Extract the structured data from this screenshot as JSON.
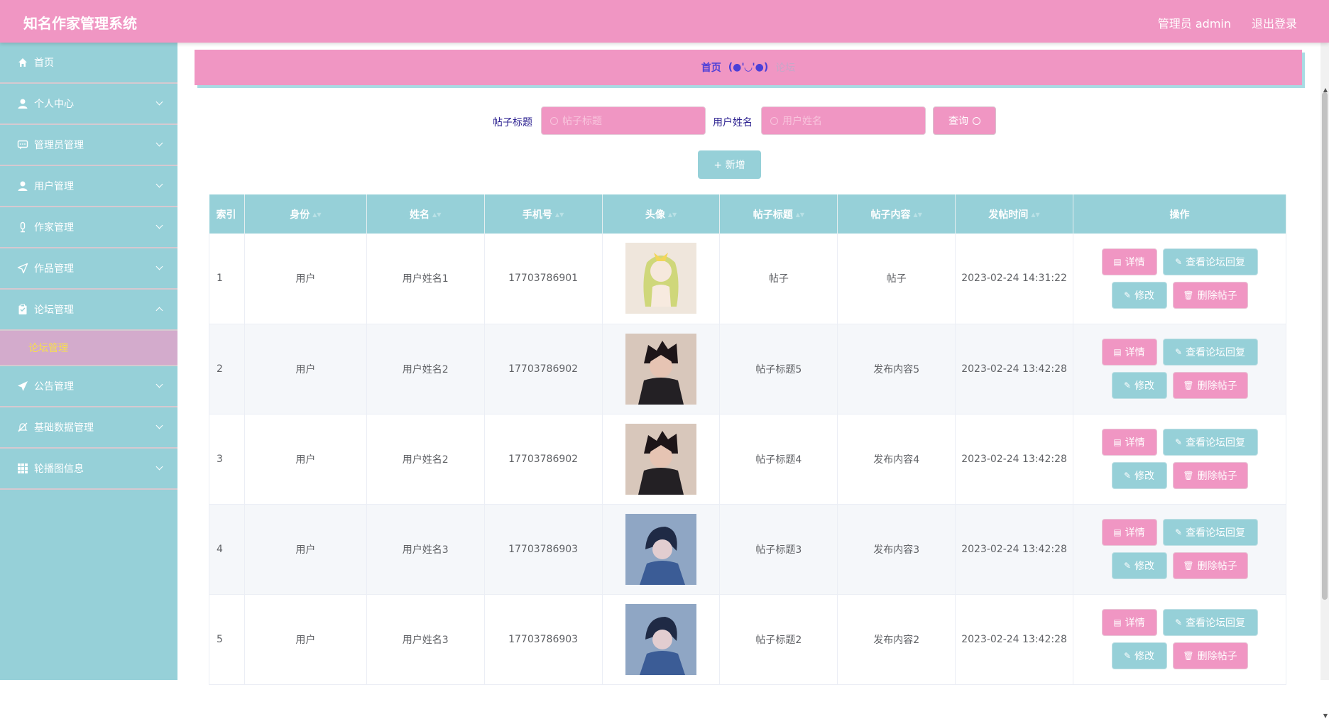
{
  "header": {
    "title": "知名作家管理系统",
    "admin": "管理员 admin",
    "logout": "退出登录"
  },
  "sidebar": {
    "items": [
      {
        "label": "首页",
        "icon": "home-icon"
      },
      {
        "label": "个人中心",
        "icon": "user-icon"
      },
      {
        "label": "管理员管理",
        "icon": "chat-icon"
      },
      {
        "label": "用户管理",
        "icon": "user-icon"
      },
      {
        "label": "作家管理",
        "icon": "microphone-icon"
      },
      {
        "label": "作品管理",
        "icon": "send-icon"
      },
      {
        "label": "论坛管理",
        "icon": "clipboard-icon",
        "expanded": true
      },
      {
        "label": "公告管理",
        "icon": "paper-plane-icon"
      },
      {
        "label": "基础数据管理",
        "icon": "bell-off-icon"
      },
      {
        "label": "轮播图信息",
        "icon": "grid-icon"
      }
    ],
    "submenu_label": "论坛管理"
  },
  "breadcrumb": {
    "home": "首页",
    "separator": "(●'◡'●)",
    "current": "论坛"
  },
  "search": {
    "title_label": "帖子标题",
    "title_placeholder": "帖子标题",
    "name_label": "用户姓名",
    "name_placeholder": "用户姓名",
    "query_label": "查询"
  },
  "add_label": "+ 新增",
  "table": {
    "headers": [
      "索引",
      "身份",
      "姓名",
      "手机号",
      "头像",
      "帖子标题",
      "帖子内容",
      "发帖时间",
      "操作"
    ],
    "rows": [
      {
        "index": "1",
        "role": "用户",
        "name": "用户姓名1",
        "phone": "17703786901",
        "title": "帖子",
        "content": "帖子",
        "time": "2023-02-24 14:31:22"
      },
      {
        "index": "2",
        "role": "用户",
        "name": "用户姓名2",
        "phone": "17703786902",
        "title": "帖子标题5",
        "content": "发布内容5",
        "time": "2023-02-24 13:42:28"
      },
      {
        "index": "3",
        "role": "用户",
        "name": "用户姓名2",
        "phone": "17703786902",
        "title": "帖子标题4",
        "content": "发布内容4",
        "time": "2023-02-24 13:42:28"
      },
      {
        "index": "4",
        "role": "用户",
        "name": "用户姓名3",
        "phone": "17703786903",
        "title": "帖子标题3",
        "content": "发布内容3",
        "time": "2023-02-24 13:42:28"
      },
      {
        "index": "5",
        "role": "用户",
        "name": "用户姓名3",
        "phone": "17703786903",
        "title": "帖子标题2",
        "content": "发布内容2",
        "time": "2023-02-24 13:42:28"
      }
    ],
    "actions": {
      "detail": "详情",
      "view_reply": "查看论坛回复",
      "edit": "修改",
      "delete": "删除帖子"
    }
  },
  "colors": {
    "primary_pink": "#f096c3",
    "primary_teal": "#96d0d8",
    "active_text": "#f7e04a"
  }
}
